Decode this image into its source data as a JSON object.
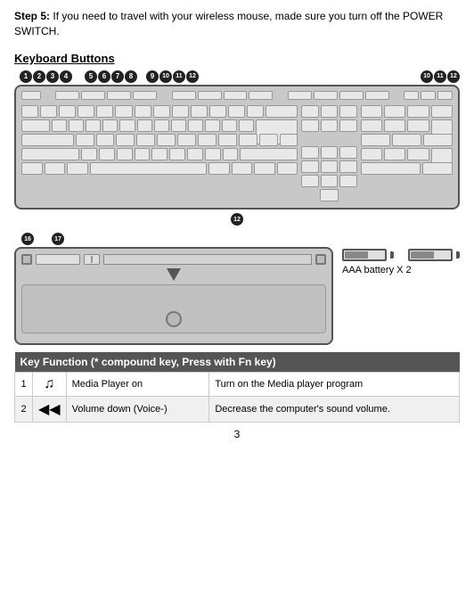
{
  "step": {
    "number": "Step 5:",
    "text": "If you need to travel with your wireless mouse, made sure you turn off the POWER SWITCH."
  },
  "section_title": "Keyboard Buttons",
  "bubbles_top": {
    "left": [
      "1",
      "2",
      "3",
      "4",
      "5",
      "6",
      "7",
      "8",
      "9",
      "10",
      "11",
      "12"
    ],
    "right": [
      "10",
      "11",
      "12"
    ]
  },
  "bubble_bottom_main": "12",
  "bubble_bottom_left": "16",
  "bubble_bottom_right": "17",
  "battery_label": "AAA battery X 2",
  "table": {
    "header": "Key Function (* compound key, Press with Fn key)",
    "rows": [
      {
        "num": "1",
        "icon": "♫",
        "function": "Media Player on",
        "description": "Turn on the Media player program"
      },
      {
        "num": "2",
        "icon": "◀◀",
        "function": "Volume down (Voice-)",
        "description": "Decrease the computer's sound volume."
      }
    ]
  },
  "page_number": "3"
}
